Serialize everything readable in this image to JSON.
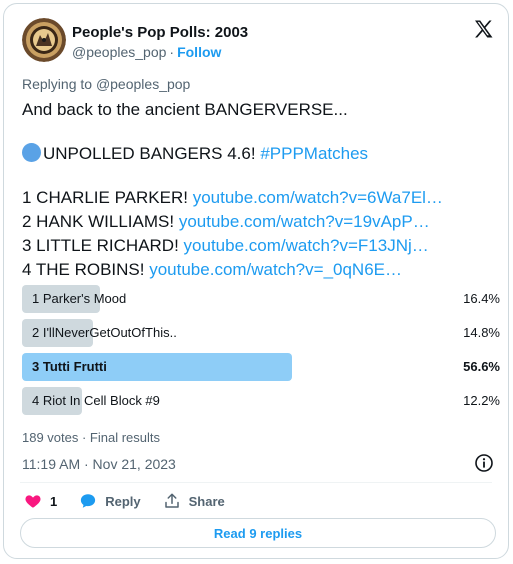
{
  "author": {
    "name": "People's Pop Polls: 2003",
    "handle": "@peoples_pop",
    "follow_label": "Follow",
    "separator": "·"
  },
  "replying": {
    "prefix": "Replying to ",
    "mention": "@peoples_pop"
  },
  "tweet": {
    "line1": "And back to the ancient BANGERVERSE...",
    "heading_text": "UNPOLLED BANGERS 4.6! ",
    "hashtag": "#PPPMatches",
    "tracks": [
      {
        "text": "1 CHARLIE PARKER! ",
        "link": "youtube.com/watch?v=6Wa7El…"
      },
      {
        "text": "2 HANK WILLIAMS! ",
        "link": "youtube.com/watch?v=19vApP…"
      },
      {
        "text": "3 LITTLE RICHARD! ",
        "link": "youtube.com/watch?v=F13JNj…"
      },
      {
        "text": "4 THE ROBINS! ",
        "link": "youtube.com/watch?v=_0qN6E…"
      }
    ]
  },
  "poll": {
    "options": [
      {
        "label": "1 Parker's Mood",
        "percent": "16.4%",
        "value": 16.4,
        "winner": false
      },
      {
        "label": "2 I'llNeverGetOutOfThis..",
        "percent": "14.8%",
        "value": 14.8,
        "winner": false
      },
      {
        "label": "3 Tutti Frutti",
        "percent": "56.6%",
        "value": 56.6,
        "winner": true
      },
      {
        "label": "4 Riot In Cell Block #9",
        "percent": "12.2%",
        "value": 12.2,
        "winner": false
      }
    ],
    "summary": "189 votes · Final results"
  },
  "timestamp": "11:19 AM · Nov 21, 2023",
  "actions": {
    "like_count": "1",
    "reply_label": "Reply",
    "share_label": "Share"
  },
  "read_replies_label": "Read 9 replies",
  "colors": {
    "accent": "#1d9bf0",
    "like": "#f91880",
    "winner_bar": "#8ecdf7",
    "bar": "#cfd9de"
  }
}
